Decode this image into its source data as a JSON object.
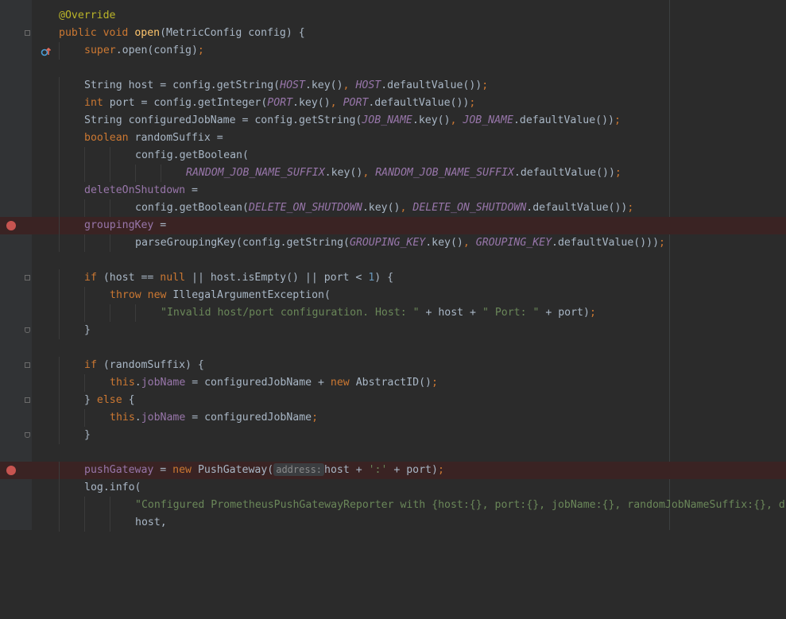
{
  "code": {
    "annotation": "@Override",
    "kw_public": "public",
    "kw_void": "void",
    "method_open": "open",
    "params_open": "(MetricConfig config) {",
    "kw_super": "super",
    "super_call": ".open(config)",
    "semi": ";",
    "str_host_decl": "String host = config.getString(",
    "const_host": "HOST",
    "key_call": ".key()",
    "comma": ", ",
    "default_call": ".defaultValue())",
    "kw_int": "int",
    "port_decl": " port = config.getInteger(",
    "const_port": "PORT",
    "str_jobname_decl": "String configuredJobName = config.getString(",
    "const_job_name": "JOB_NAME",
    "kw_boolean": "boolean",
    "random_suffix_decl": " randomSuffix =",
    "get_boolean_open": "config.getBoolean(",
    "const_random_suffix": "RANDOM_JOB_NAME_SUFFIX",
    "field_delete_on_shutdown": "deleteOnShutdown",
    "assign": " =",
    "get_boolean_call": "config.getBoolean(",
    "const_delete_on_shutdown": "DELETE_ON_SHUTDOWN",
    "field_grouping_key": "groupingKey",
    "parse_grouping_call": "parseGroupingKey(config.getString(",
    "const_grouping_key": "GROUPING_KEY",
    "default_call_triple": ".defaultValue()))",
    "kw_if": "if",
    "if_host_cond_a": " (host == ",
    "kw_null": "null",
    "if_host_cond_b": " || host.isEmpty() || port < ",
    "num_one": "1",
    "if_host_cond_c": ") {",
    "kw_throw": "throw",
    "kw_new": "new",
    "illegal_arg": " IllegalArgumentException(",
    "str_invalid": "\"Invalid host/port configuration. Host: \"",
    "plus_host_plus": " + host + ",
    "str_port": "\" Port: \"",
    "plus_port": " + port)",
    "close_brace": "}",
    "if_random_cond": " (randomSuffix) {",
    "kw_this": "this",
    "dot": ".",
    "field_job_name": "jobName",
    "assign_configured": " = configuredJobName + ",
    "abstract_id_call": " AbstractID()",
    "else_open_brace": "} ",
    "kw_else": "else",
    "brace_open": " {",
    "assign_configured_only": " = configuredJobName",
    "field_push_gateway": "pushGateway",
    "assign_eq": " = ",
    "push_gateway_ctor": " PushGateway(",
    "hint_address": "address:",
    "host_plus": "host + ",
    "str_colon": "':'",
    "plus_port_close": " + port)",
    "log_info": "log.info(",
    "str_configured": "\"Configured PrometheusPushGatewayReporter with {host:{}, port:{}, jobName:{}, randomJobNameSuffix:{}, d",
    "host_comma": "host,"
  },
  "colors": {
    "background": "#2b2b2b",
    "keyword": "#cc7832",
    "annotation": "#bbb529",
    "method_declaration": "#ffc66d",
    "constant": "#9876aa",
    "string": "#6a8759",
    "number": "#6897bb",
    "breakpoint": "#c75450",
    "breakpoint_line": "#3a2323"
  },
  "gutter": {
    "override_icon": "override-method-icon",
    "breakpoint_icon": "breakpoint-icon",
    "fold_icon": "fold-icon"
  }
}
